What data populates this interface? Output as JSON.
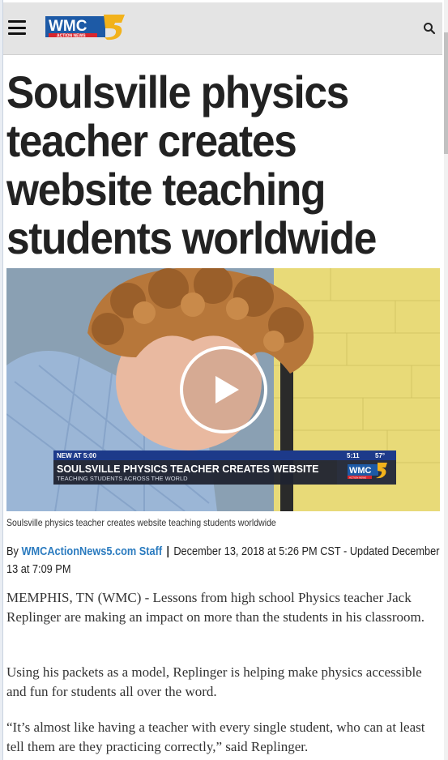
{
  "header": {
    "logo_text": "WMC",
    "logo_sub": "ACTION NEWS",
    "logo_number": "5"
  },
  "article": {
    "headline": "Soulsville physics teacher creates website teaching students worldwide",
    "caption": "Soulsville physics teacher creates website teaching students worldwide",
    "byline_prefix": "By",
    "byline_author": "WMCActionNews5.com Staff",
    "byline_separator": "|",
    "byline_date": "December 13, 2018 at 5:26 PM CST - Updated December 13 at 7:09 PM",
    "paragraphs": [
      "MEMPHIS, TN (WMC) - Lessons from high school Physics teacher Jack Replinger are making an impact on more than the students in his classroom.",
      "Using his packets as a model, Replinger is helping make physics accessible and fun for students all over the word.",
      "“It’s almost like having a teacher with every single student, who can at least tell them are they practicing correctly,” said Replinger."
    ]
  },
  "video": {
    "lower_third_tag": "NEW AT 5:00",
    "lower_third_time": "5:11",
    "lower_third_temp": "57°",
    "lower_third_title": "SOULSVILLE PHYSICS TEACHER CREATES WEBSITE",
    "lower_third_subtitle": "TEACHING STUDENTS ACROSS THE WORLD",
    "lower_third_logo": "WMC",
    "lower_third_logo_sub": "ACTION NEWS"
  },
  "colors": {
    "logo_blue": "#1d5aa6",
    "logo_red": "#d8262e",
    "logo_gold": "#f2b21b",
    "link_blue": "#2b7bbf",
    "lower_third_blue": "#1d3a8a",
    "lower_third_dark": "#1f2330"
  }
}
